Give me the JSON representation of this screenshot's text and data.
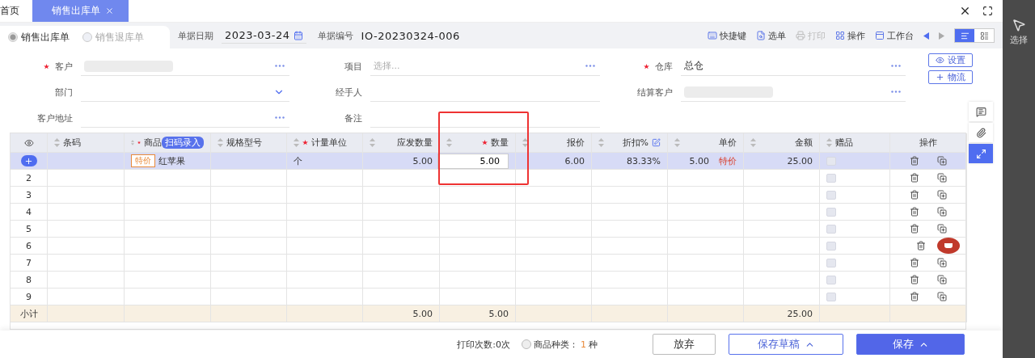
{
  "tabs": [
    {
      "label": "首页",
      "selected": false
    },
    {
      "label": "销售出库单",
      "selected": true
    }
  ],
  "doc_types": [
    {
      "label": "销售出库单",
      "selected": true
    },
    {
      "label": "销售退库单",
      "selected": false
    }
  ],
  "doc_date": {
    "label": "单据日期",
    "value": "2023-03-24"
  },
  "doc_number": {
    "label": "单据编号",
    "value": "IO-20230324-006"
  },
  "toolbar": [
    {
      "kind": "shortcut",
      "label": "快捷键",
      "disabled": false
    },
    {
      "kind": "pick",
      "label": "选单",
      "disabled": false
    },
    {
      "kind": "print",
      "label": "打印",
      "disabled": true
    },
    {
      "kind": "ops",
      "label": "操作",
      "disabled": false
    },
    {
      "kind": "desk",
      "label": "工作台",
      "disabled": false
    }
  ],
  "view_modes": [
    {
      "kind": "list",
      "selected": true
    },
    {
      "kind": "cards",
      "selected": false
    }
  ],
  "form_fields": [
    {
      "label": "客户",
      "required": true,
      "kind": "lookup",
      "redacted": true
    },
    {
      "label": "项目",
      "required": false,
      "kind": "lookup",
      "placeholder": "选择..."
    },
    {
      "label": "仓库",
      "required": true,
      "kind": "lookup",
      "value": "总仓"
    },
    {
      "label": "部门",
      "required": false,
      "kind": "dropdown"
    },
    {
      "label": "经手人",
      "required": false,
      "kind": "text"
    },
    {
      "label": "结算客户",
      "required": false,
      "kind": "lookup",
      "redacted": true
    },
    {
      "label": "客户地址",
      "required": false,
      "kind": "lookup"
    },
    {
      "label": "备注",
      "required": false,
      "kind": "text"
    }
  ],
  "side_buttons": [
    {
      "kind": "settings",
      "label": "设置"
    },
    {
      "kind": "logistics",
      "label": "物流"
    }
  ],
  "table": {
    "columns": [
      {
        "label": "条码",
        "sortable": true,
        "required": false
      },
      {
        "label": "商品",
        "sortable": true,
        "required": true,
        "badge": "扫码录入"
      },
      {
        "label": "规格型号",
        "sortable": true,
        "required": false
      },
      {
        "label": "计量单位",
        "sortable": true,
        "required": true
      },
      {
        "label": "应发数量",
        "sortable": true,
        "required": false
      },
      {
        "label": "数量",
        "sortable": true,
        "required": true
      },
      {
        "label": "报价",
        "sortable": true,
        "required": false
      },
      {
        "label": "折扣%",
        "sortable": true,
        "required": false,
        "editable": true
      },
      {
        "label": "单价",
        "sortable": true,
        "required": false
      },
      {
        "label": "金额",
        "sortable": true,
        "required": false
      },
      {
        "label": "赠品",
        "sortable": true,
        "required": false
      },
      {
        "label": "操作",
        "sortable": false,
        "required": false
      }
    ],
    "rows": [
      {
        "selected": true,
        "marked": false,
        "product_tag": "特价",
        "product": "红苹果",
        "unit": "个",
        "shipped_qty": "5.00",
        "qty": "5.00",
        "quote": "6.00",
        "discount": "83.33%",
        "unit_price": "5.00",
        "price_tag": "特价",
        "amount": "25.00",
        "gift": false
      },
      {
        "selected": false,
        "marked": false,
        "number": "2",
        "gift": false
      },
      {
        "selected": false,
        "marked": false,
        "number": "3",
        "gift": false
      },
      {
        "selected": false,
        "marked": false,
        "number": "4",
        "gift": false
      },
      {
        "selected": false,
        "marked": false,
        "number": "5",
        "gift": false
      },
      {
        "selected": false,
        "marked": true,
        "number": "6",
        "gift": false
      },
      {
        "selected": false,
        "marked": false,
        "number": "7",
        "gift": false
      },
      {
        "selected": false,
        "marked": false,
        "number": "8",
        "gift": false
      },
      {
        "selected": false,
        "marked": false,
        "number": "9",
        "gift": false
      }
    ],
    "subtotal": {
      "label": "小计",
      "shipped_qty": "5.00",
      "qty": "5.00",
      "amount": "25.00"
    }
  },
  "footer": {
    "print_count": "打印次数:0次",
    "kinds_label": "商品种类：",
    "kinds_count": "1",
    "kinds_unit": "种",
    "buttons": [
      {
        "kind": "plain",
        "label": "放弃"
      },
      {
        "kind": "outline",
        "label": "保存草稿"
      },
      {
        "kind": "primary",
        "label": "保存"
      }
    ]
  },
  "side_panel": {
    "label": "选择"
  }
}
